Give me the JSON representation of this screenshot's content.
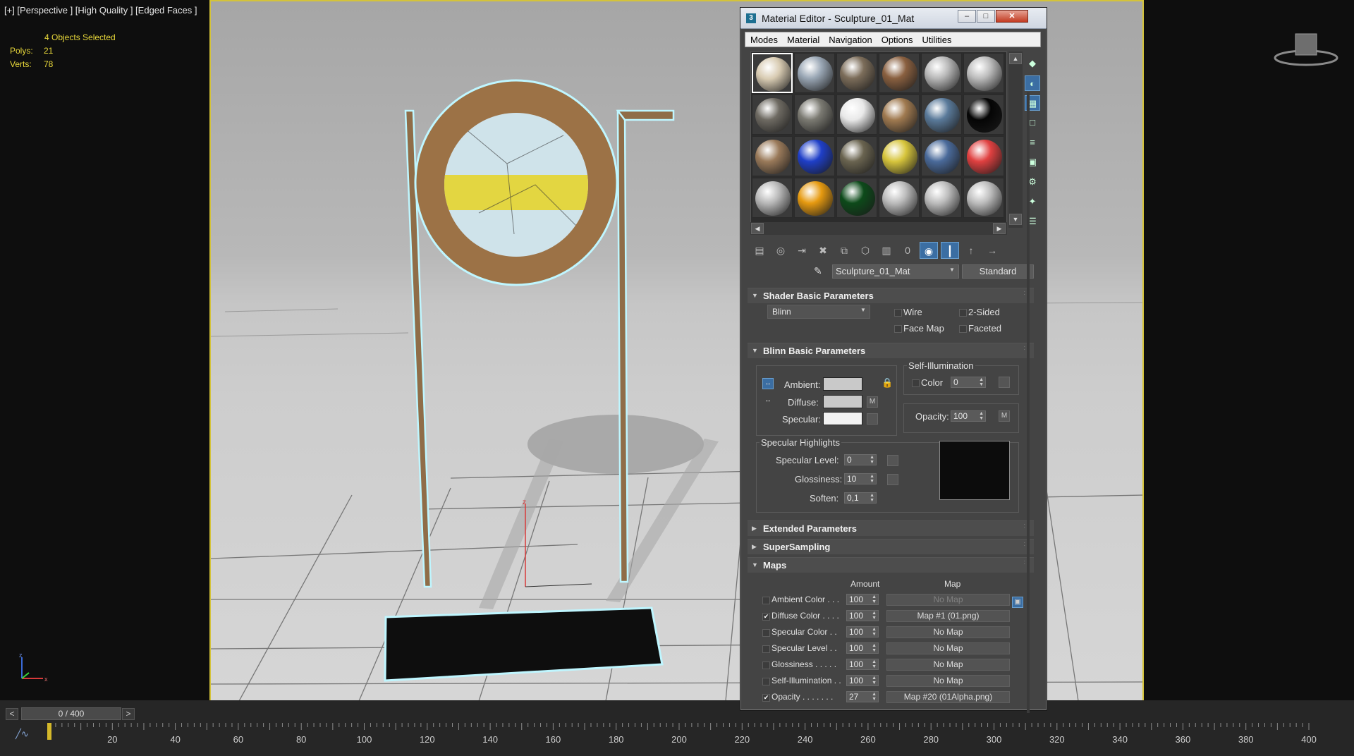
{
  "viewport": {
    "label": "[+] [Perspective ] [High Quality ] [Edged Faces ]",
    "selection": "4 Objects Selected",
    "polys_label": "Polys:",
    "polys_value": "21",
    "verts_label": "Verts:",
    "verts_value": "78"
  },
  "timeline": {
    "frame_display": "0 / 400",
    "prev": "<",
    "next": ">",
    "ticks": [
      "20",
      "40",
      "60",
      "80",
      "100",
      "120",
      "140",
      "160",
      "180",
      "200",
      "220",
      "240",
      "260",
      "280",
      "300",
      "320",
      "340",
      "360",
      "380",
      "400"
    ]
  },
  "material_editor": {
    "title": "Material Editor - Sculpture_01_Mat",
    "menu": [
      "Modes",
      "Material",
      "Navigation",
      "Options",
      "Utilities"
    ],
    "material_name": "Sculpture_01_Mat",
    "material_type": "Standard",
    "slot_colors": [
      [
        "#d8cbb2",
        "#9aa7b5",
        "#7c6d5a",
        "#8a6040",
        "#b9b9b9",
        "#bdbdbd"
      ],
      [
        "#6e6a62",
        "#7b7a72",
        "#e9e9e9",
        "#a07a50",
        "#5a7a9a",
        "#050505"
      ],
      [
        "#9a7a5a",
        "#1f3fc8",
        "#6a6450",
        "#d7c53c",
        "#4a6a9a",
        "#e04040"
      ],
      [
        "#b9b9b9",
        "#e69a10",
        "#0d4a1a",
        "#bcbcbc",
        "#bdbdbd",
        "#bdbdbd"
      ]
    ],
    "shader_basic": {
      "header": "Shader Basic Parameters",
      "shader": "Blinn",
      "wire": "Wire",
      "two_sided": "2-Sided",
      "face_map": "Face Map",
      "faceted": "Faceted"
    },
    "blinn_basic": {
      "header": "Blinn Basic Parameters",
      "self_illum_title": "Self-Illumination",
      "color_label": "Color",
      "color_value": "0",
      "ambient": "Ambient:",
      "diffuse": "Diffuse:",
      "specular": "Specular:",
      "opacity_label": "Opacity:",
      "opacity_value": "100",
      "m": "M",
      "ambient_color": "#c9c9c9",
      "diffuse_color": "#c9c9c9",
      "specular_color": "#f2f2f2"
    },
    "specular_highlights": {
      "title": "Specular Highlights",
      "spec_level_label": "Specular Level:",
      "spec_level_value": "0",
      "glossiness_label": "Glossiness:",
      "glossiness_value": "10",
      "soften_label": "Soften:",
      "soften_value": "0,1"
    },
    "rollouts": [
      "Extended Parameters",
      "SuperSampling",
      "Maps"
    ],
    "maps": {
      "amount_header": "Amount",
      "map_header": "Map",
      "rows": [
        {
          "label": "Ambient Color . . .",
          "checked": false,
          "amount": "100",
          "map": "No Map"
        },
        {
          "label": "Diffuse Color . . . .",
          "checked": true,
          "amount": "100",
          "map": "Map #1 (01.png)"
        },
        {
          "label": "Specular Color . .",
          "checked": false,
          "amount": "100",
          "map": "No Map"
        },
        {
          "label": "Specular Level . .",
          "checked": false,
          "amount": "100",
          "map": "No Map"
        },
        {
          "label": "Glossiness . . . . .",
          "checked": false,
          "amount": "100",
          "map": "No Map"
        },
        {
          "label": "Self-Illumination . .",
          "checked": false,
          "amount": "100",
          "map": "No Map"
        },
        {
          "label": "Opacity . . . . . . .",
          "checked": true,
          "amount": "27",
          "map": "Map #20 (01Alpha.png)"
        }
      ]
    }
  }
}
